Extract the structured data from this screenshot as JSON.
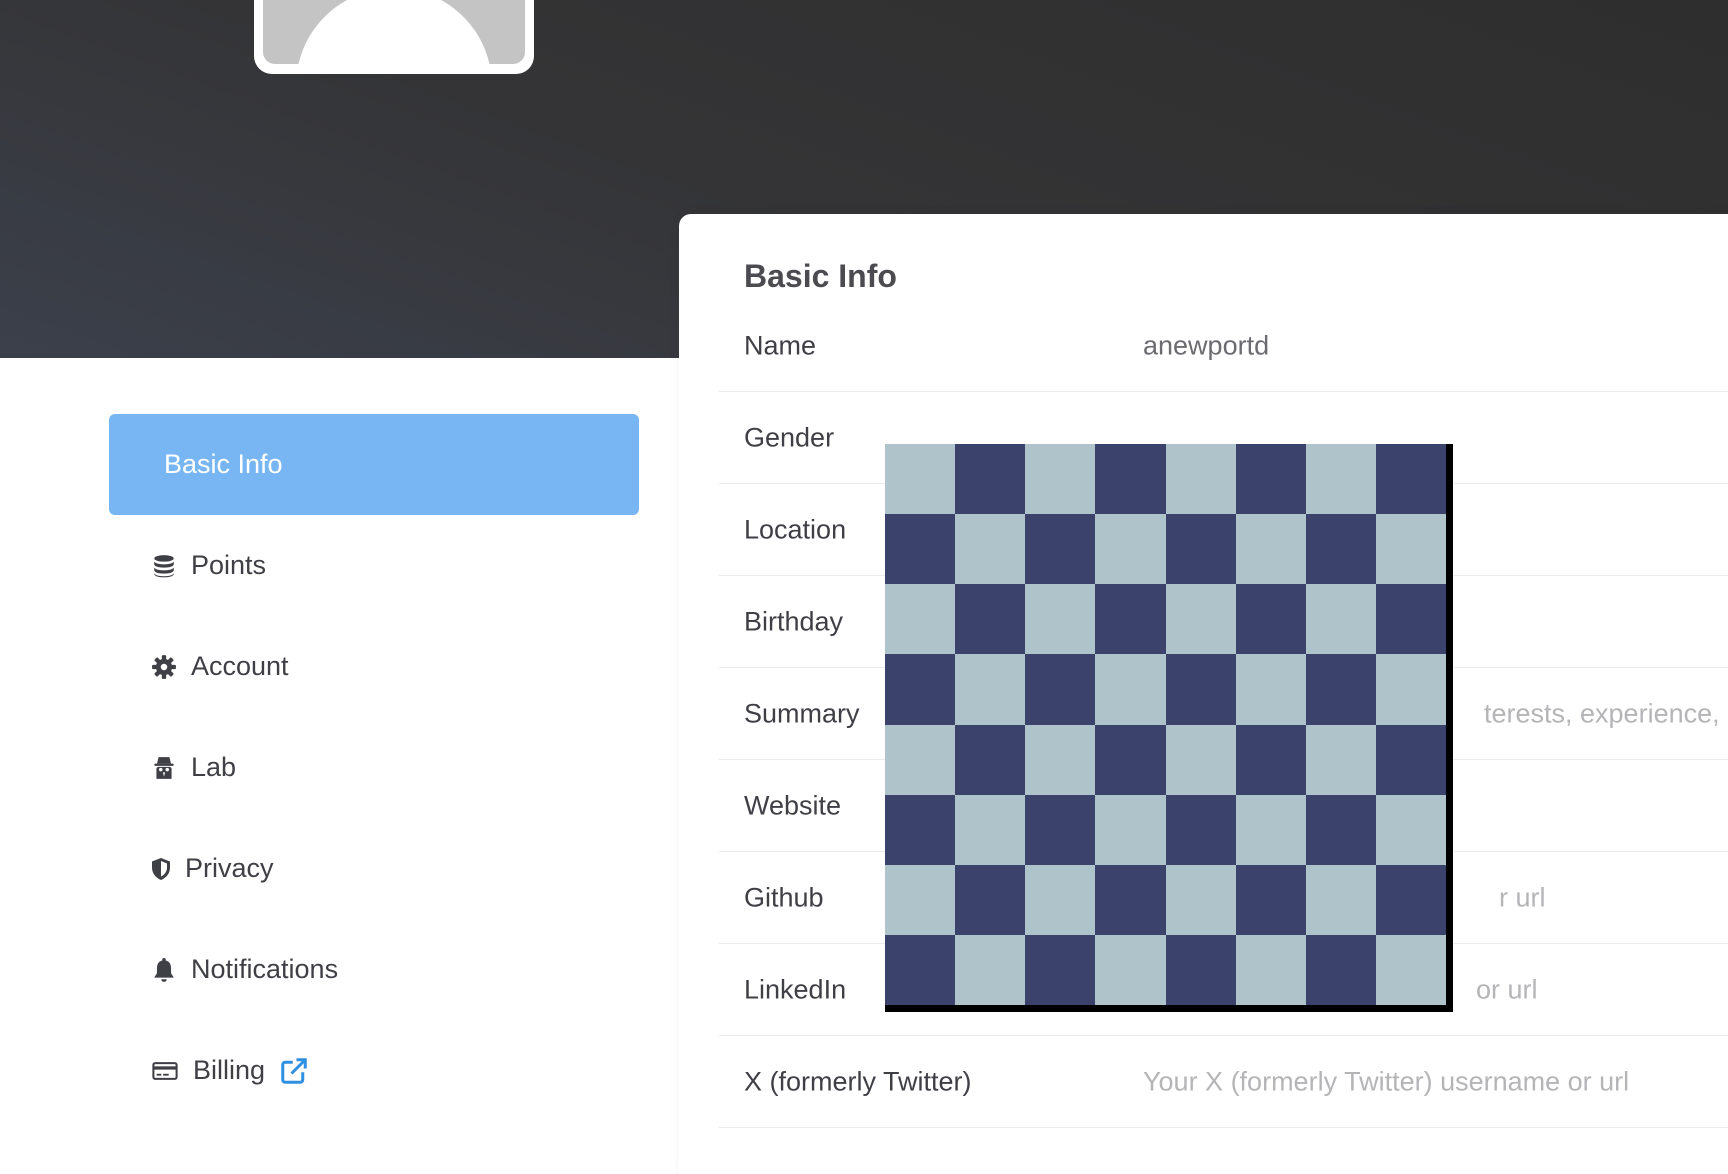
{
  "sidebar": {
    "items": [
      {
        "label": "Basic Info",
        "icon": "none",
        "active": true
      },
      {
        "label": "Points",
        "icon": "database-icon",
        "active": false
      },
      {
        "label": "Account",
        "icon": "gear-icon",
        "active": false
      },
      {
        "label": "Lab",
        "icon": "spy-icon",
        "active": false
      },
      {
        "label": "Privacy",
        "icon": "shield-icon",
        "active": false
      },
      {
        "label": "Notifications",
        "icon": "bell-icon",
        "active": false
      },
      {
        "label": "Billing",
        "icon": "credit-card-icon",
        "active": false,
        "external": true
      }
    ]
  },
  "card": {
    "title": "Basic Info",
    "fields": [
      {
        "label": "Name",
        "value": "anewportd",
        "placeholder": false
      },
      {
        "label": "Gender",
        "value": "",
        "placeholder": false
      },
      {
        "label": "Location",
        "value": "",
        "placeholder": false
      },
      {
        "label": "Birthday",
        "value": "",
        "placeholder": false
      },
      {
        "label": "Summary",
        "value": "terests, experience, e",
        "placeholder": true
      },
      {
        "label": "Website",
        "value": "",
        "placeholder": false
      },
      {
        "label": "Github",
        "value": "r url",
        "placeholder": true
      },
      {
        "label": "LinkedIn",
        "value": "or url",
        "placeholder": true
      },
      {
        "label": "X (formerly Twitter)",
        "value": "Your X (formerly Twitter) username or url",
        "placeholder": true
      }
    ]
  },
  "overlay": {
    "grid_size": 8,
    "colors": {
      "dark": "#3b436c",
      "light": "#aec3ca",
      "border": "#000000"
    }
  },
  "colors": {
    "accent": "#77b6f2",
    "banner": "#333333",
    "link_icon": "#2f8fe0"
  }
}
